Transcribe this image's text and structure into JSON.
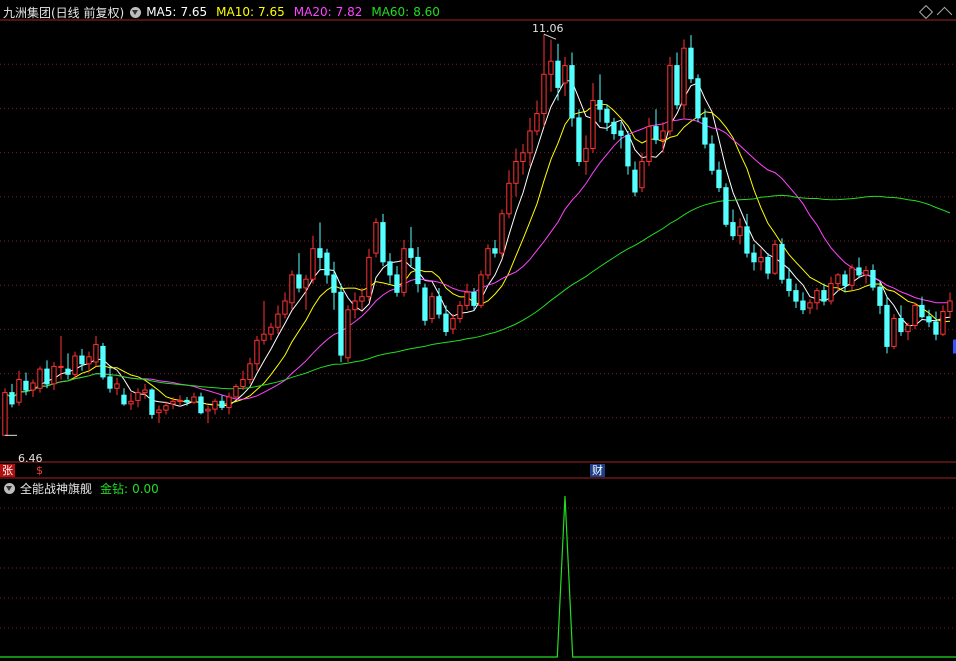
{
  "header": {
    "title": "九洲集团(日线 前复权)",
    "legend": [
      {
        "label": "MA5:",
        "value": "7.65",
        "color": "#ffffff"
      },
      {
        "label": "MA10:",
        "value": "7.65",
        "color": "#ffff00"
      },
      {
        "label": "MA20:",
        "value": "7.82",
        "color": "#ff44ff"
      },
      {
        "label": "MA60:",
        "value": "8.60",
        "color": "#22dd22"
      }
    ]
  },
  "indicator": {
    "title": "全能战神旗舰",
    "legend": [
      {
        "label": "金钻:",
        "value": "0.00",
        "color": "#22dd22"
      }
    ]
  },
  "annotations": {
    "high": "11.06",
    "low": "6.46",
    "zhang": "张",
    "jia": "$",
    "cai": "财"
  },
  "colors": {
    "up": "#ff3232",
    "down": "#54ffff",
    "grid": "#7a1e1e",
    "border": "#a02424"
  },
  "chart_data": [
    {
      "type": "candlestick",
      "title": "九洲集团(日线 前复权)",
      "y_range": [
        6.2,
        11.2
      ],
      "high_label": 11.06,
      "low_label": 6.46,
      "ohlc": [
        [
          6.46,
          7.0,
          6.46,
          6.95
        ],
        [
          6.95,
          7.05,
          6.78,
          6.82
        ],
        [
          6.84,
          7.2,
          6.8,
          7.1
        ],
        [
          7.08,
          7.18,
          6.92,
          6.98
        ],
        [
          6.98,
          7.1,
          6.9,
          7.06
        ],
        [
          7.0,
          7.25,
          6.95,
          7.22
        ],
        [
          7.22,
          7.32,
          7.0,
          7.05
        ],
        [
          7.05,
          7.3,
          6.98,
          7.25
        ],
        [
          7.25,
          7.6,
          7.1,
          7.25
        ],
        [
          7.22,
          7.4,
          7.1,
          7.16
        ],
        [
          7.16,
          7.42,
          7.12,
          7.37
        ],
        [
          7.37,
          7.45,
          7.2,
          7.28
        ],
        [
          7.28,
          7.42,
          7.18,
          7.36
        ],
        [
          7.3,
          7.6,
          7.25,
          7.5
        ],
        [
          7.48,
          7.52,
          7.1,
          7.13
        ],
        [
          7.13,
          7.25,
          6.95,
          7.0
        ],
        [
          7.0,
          7.12,
          6.92,
          7.05
        ],
        [
          6.92,
          7.0,
          6.8,
          6.82
        ],
        [
          6.82,
          6.95,
          6.75,
          6.85
        ],
        [
          6.86,
          7.0,
          6.78,
          6.95
        ],
        [
          6.95,
          7.05,
          6.88,
          6.98
        ],
        [
          6.98,
          7.0,
          6.65,
          6.7
        ],
        [
          6.72,
          6.8,
          6.6,
          6.75
        ],
        [
          6.75,
          6.85,
          6.7,
          6.8
        ],
        [
          6.82,
          6.9,
          6.76,
          6.85
        ],
        [
          6.85,
          6.92,
          6.79,
          6.86
        ],
        [
          6.86,
          6.9,
          6.8,
          6.84
        ],
        [
          6.84,
          6.95,
          6.82,
          6.9
        ],
        [
          6.9,
          6.95,
          6.7,
          6.72
        ],
        [
          6.74,
          6.8,
          6.6,
          6.76
        ],
        [
          6.76,
          6.88,
          6.7,
          6.85
        ],
        [
          6.85,
          6.92,
          6.75,
          6.78
        ],
        [
          6.78,
          6.95,
          6.7,
          6.9
        ],
        [
          6.9,
          7.05,
          6.88,
          7.02
        ],
        [
          7.02,
          7.2,
          6.98,
          7.1
        ],
        [
          7.1,
          7.35,
          7.05,
          7.28
        ],
        [
          7.28,
          7.6,
          7.2,
          7.55
        ],
        [
          7.55,
          8.0,
          7.5,
          7.62
        ],
        [
          7.62,
          7.75,
          7.55,
          7.7
        ],
        [
          7.7,
          7.95,
          7.62,
          7.85
        ],
        [
          7.85,
          8.1,
          7.8,
          8.0
        ],
        [
          7.98,
          8.35,
          7.9,
          8.3
        ],
        [
          8.3,
          8.55,
          8.1,
          8.15
        ],
        [
          8.15,
          8.3,
          7.9,
          8.25
        ],
        [
          8.25,
          8.75,
          8.2,
          8.6
        ],
        [
          8.6,
          8.9,
          8.35,
          8.5
        ],
        [
          8.55,
          8.6,
          8.2,
          8.3
        ],
        [
          8.3,
          8.45,
          7.9,
          8.1
        ],
        [
          8.1,
          8.2,
          7.3,
          7.38
        ],
        [
          7.35,
          7.95,
          7.3,
          7.9
        ],
        [
          7.9,
          8.1,
          7.8,
          8.0
        ],
        [
          8.0,
          8.15,
          7.9,
          8.05
        ],
        [
          8.05,
          8.6,
          8.0,
          8.5
        ],
        [
          8.55,
          8.95,
          8.5,
          8.9
        ],
        [
          8.9,
          9.0,
          8.4,
          8.45
        ],
        [
          8.45,
          8.55,
          8.2,
          8.3
        ],
        [
          8.3,
          8.4,
          8.05,
          8.1
        ],
        [
          8.1,
          8.7,
          8.05,
          8.6
        ],
        [
          8.6,
          8.85,
          8.4,
          8.5
        ],
        [
          8.5,
          8.62,
          8.1,
          8.2
        ],
        [
          8.15,
          8.2,
          7.72,
          7.78
        ],
        [
          7.8,
          8.1,
          7.75,
          8.05
        ],
        [
          8.05,
          8.15,
          7.8,
          7.85
        ],
        [
          7.85,
          7.95,
          7.6,
          7.65
        ],
        [
          7.68,
          7.85,
          7.62,
          7.8
        ],
        [
          7.8,
          8.0,
          7.75,
          7.95
        ],
        [
          7.95,
          8.2,
          7.9,
          8.1
        ],
        [
          8.1,
          8.15,
          7.9,
          7.95
        ],
        [
          7.95,
          8.35,
          7.92,
          8.3
        ],
        [
          8.3,
          8.65,
          8.25,
          8.6
        ],
        [
          8.6,
          8.7,
          8.5,
          8.55
        ],
        [
          8.55,
          9.05,
          8.5,
          9.0
        ],
        [
          9.0,
          9.5,
          8.95,
          9.35
        ],
        [
          9.35,
          9.75,
          9.2,
          9.6
        ],
        [
          9.6,
          9.8,
          9.45,
          9.7
        ],
        [
          9.7,
          10.1,
          9.55,
          9.95
        ],
        [
          9.95,
          10.3,
          9.9,
          10.15
        ],
        [
          10.15,
          11.06,
          10.0,
          10.6
        ],
        [
          10.6,
          11.0,
          10.4,
          10.75
        ],
        [
          10.75,
          10.95,
          10.3,
          10.45
        ],
        [
          10.5,
          10.8,
          10.35,
          10.7
        ],
        [
          10.7,
          10.85,
          10.0,
          10.1
        ],
        [
          10.1,
          10.2,
          9.55,
          9.6
        ],
        [
          9.6,
          9.9,
          9.45,
          9.75
        ],
        [
          9.75,
          10.5,
          9.7,
          10.3
        ],
        [
          10.3,
          10.6,
          10.05,
          10.2
        ],
        [
          10.2,
          10.25,
          9.95,
          10.05
        ],
        [
          10.05,
          10.1,
          9.85,
          9.92
        ],
        [
          9.95,
          10.05,
          9.75,
          9.9
        ],
        [
          9.9,
          9.95,
          9.45,
          9.55
        ],
        [
          9.5,
          9.6,
          9.2,
          9.25
        ],
        [
          9.3,
          9.7,
          9.25,
          9.6
        ],
        [
          9.6,
          10.1,
          9.55,
          10.0
        ],
        [
          10.0,
          10.2,
          9.8,
          9.85
        ],
        [
          9.85,
          10.05,
          9.7,
          9.95
        ],
        [
          9.95,
          10.8,
          9.9,
          10.7
        ],
        [
          10.7,
          10.85,
          10.2,
          10.25
        ],
        [
          10.25,
          11.0,
          10.1,
          10.9
        ],
        [
          10.9,
          11.05,
          10.5,
          10.55
        ],
        [
          10.55,
          10.6,
          10.05,
          10.1
        ],
        [
          10.1,
          10.2,
          9.75,
          9.8
        ],
        [
          9.8,
          9.9,
          9.45,
          9.5
        ],
        [
          9.5,
          9.6,
          9.25,
          9.3
        ],
        [
          9.3,
          9.35,
          8.85,
          8.88
        ],
        [
          8.9,
          9.05,
          8.7,
          8.75
        ],
        [
          8.75,
          8.95,
          8.65,
          8.85
        ],
        [
          8.85,
          9.0,
          8.5,
          8.55
        ],
        [
          8.55,
          8.65,
          8.35,
          8.45
        ],
        [
          8.45,
          8.6,
          8.35,
          8.5
        ],
        [
          8.5,
          8.55,
          8.25,
          8.32
        ],
        [
          8.32,
          8.7,
          8.3,
          8.65
        ],
        [
          8.65,
          8.72,
          8.2,
          8.25
        ],
        [
          8.25,
          8.38,
          8.05,
          8.12
        ],
        [
          8.12,
          8.2,
          7.92,
          8.0
        ],
        [
          8.0,
          8.1,
          7.85,
          7.9
        ],
        [
          7.92,
          8.02,
          7.85,
          7.98
        ],
        [
          7.98,
          8.15,
          7.9,
          8.12
        ],
        [
          8.12,
          8.2,
          7.95,
          8.0
        ],
        [
          8.0,
          8.28,
          7.96,
          8.2
        ],
        [
          8.2,
          8.32,
          8.12,
          8.3
        ],
        [
          8.3,
          8.35,
          8.1,
          8.18
        ],
        [
          8.18,
          8.42,
          8.12,
          8.38
        ],
        [
          8.38,
          8.5,
          8.26,
          8.3
        ],
        [
          8.3,
          8.4,
          8.2,
          8.35
        ],
        [
          8.35,
          8.42,
          8.12,
          8.16
        ],
        [
          8.16,
          8.22,
          7.85,
          7.95
        ],
        [
          7.95,
          8.05,
          7.4,
          7.48
        ],
        [
          7.48,
          7.85,
          7.45,
          7.8
        ],
        [
          7.8,
          7.95,
          7.6,
          7.65
        ],
        [
          7.65,
          7.75,
          7.55,
          7.72
        ],
        [
          7.72,
          7.98,
          7.68,
          7.95
        ],
        [
          7.95,
          8.05,
          7.8,
          7.82
        ],
        [
          7.82,
          7.9,
          7.7,
          7.76
        ],
        [
          7.76,
          7.88,
          7.55,
          7.62
        ],
        [
          7.62,
          7.95,
          7.6,
          7.88
        ],
        [
          7.88,
          8.1,
          7.8,
          8.0
        ]
      ],
      "ma": [
        {
          "name": "MA5",
          "window": 5,
          "color": "#ffffff"
        },
        {
          "name": "MA10",
          "window": 10,
          "color": "#ffff00"
        },
        {
          "name": "MA20",
          "window": 20,
          "color": "#ff44ff"
        },
        {
          "name": "MA60",
          "window": 60,
          "color": "#22dd22"
        }
      ]
    },
    {
      "type": "line",
      "title": "全能战神旗舰",
      "series": [
        {
          "name": "金钻",
          "color": "#22dd22",
          "spikes": [
            {
              "index": 80,
              "value": 1
            }
          ]
        }
      ],
      "y_range": [
        0,
        1
      ]
    }
  ]
}
